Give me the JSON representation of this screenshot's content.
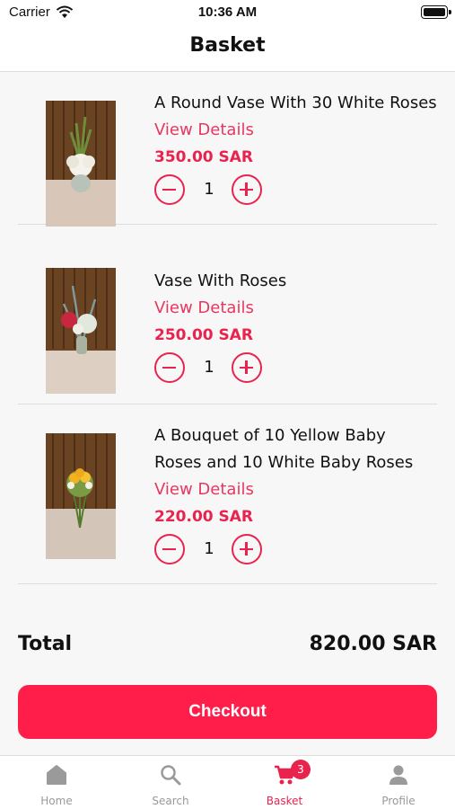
{
  "status_bar": {
    "carrier": "Carrier",
    "time": "10:36 AM"
  },
  "nav": {
    "title": "Basket"
  },
  "items": [
    {
      "name": "A Round Vase With 30 White Roses",
      "details_label": "View Details",
      "price": "350.00 SAR",
      "quantity": "1"
    },
    {
      "name": "Vase With Roses",
      "details_label": "View Details",
      "price": "250.00 SAR",
      "quantity": "1"
    },
    {
      "name": "A Bouquet of 10 Yellow Baby Roses and 10 White Baby Roses",
      "details_label": "View Details",
      "price": "220.00 SAR",
      "quantity": "1"
    }
  ],
  "summary": {
    "total_label": "Total",
    "total_value": "820.00 SAR"
  },
  "checkout_label": "Checkout",
  "tabs": [
    {
      "label": "Home",
      "icon": "home-icon"
    },
    {
      "label": "Search",
      "icon": "search-icon"
    },
    {
      "label": "Basket",
      "icon": "cart-icon",
      "badge": "3"
    },
    {
      "label": "Profile",
      "icon": "person-icon"
    }
  ],
  "colors": {
    "accent": "#e8234e",
    "checkout": "#ff1d4a",
    "inactive_tab": "#999999"
  }
}
